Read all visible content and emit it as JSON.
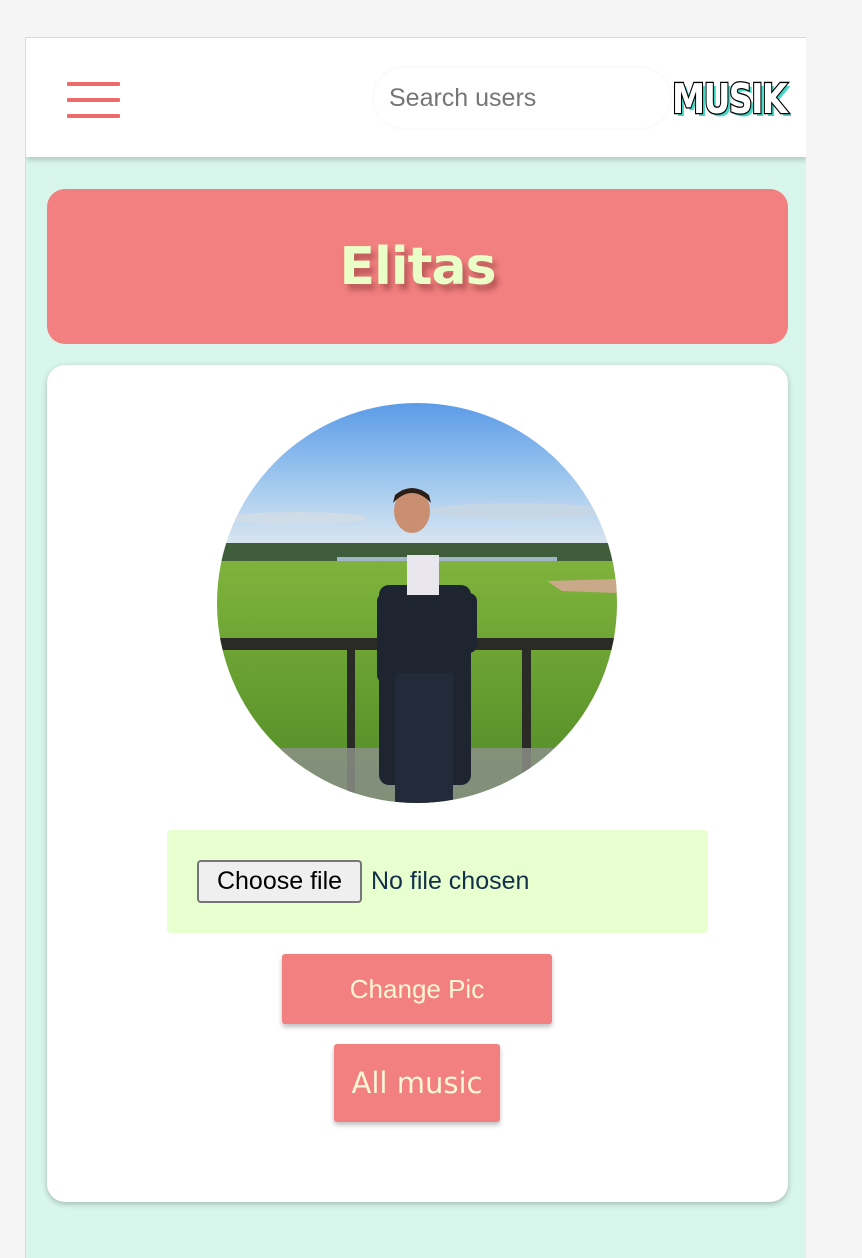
{
  "navbar": {
    "menu_icon": "hamburger-menu-icon",
    "search_placeholder": "Search users",
    "search_value": "",
    "logo_text": "MUSIK"
  },
  "profile": {
    "username": "Elitas",
    "avatar_icon": "profile-photo"
  },
  "upload": {
    "choose_label": "Choose file",
    "status": "No file chosen"
  },
  "actions": {
    "change_pic_label": "Change Pic",
    "all_music_label": "All music"
  },
  "colors": {
    "accent": "#f28080",
    "page_background": "#d8f6ec",
    "title_text": "#eaffc8",
    "upload_background": "#e8ffd0"
  }
}
